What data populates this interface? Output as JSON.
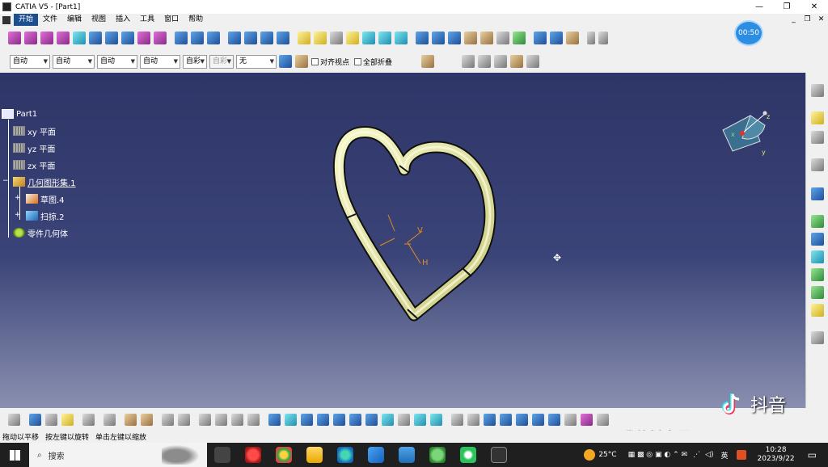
{
  "window": {
    "title": "CATIA V5 - [Part1]",
    "controls": [
      "—",
      "❐",
      "✕"
    ]
  },
  "menu": {
    "items": [
      "开始",
      "文件",
      "编辑",
      "视图",
      "插入",
      "工具",
      "窗口",
      "帮助"
    ],
    "mdi_controls": [
      "_",
      "❐",
      "✕"
    ]
  },
  "timer": {
    "label": "00:50"
  },
  "graphic_properties": {
    "combos": [
      {
        "value": "自动",
        "disabled": false
      },
      {
        "value": "自动",
        "disabled": false
      },
      {
        "value": "自动",
        "disabled": false
      },
      {
        "value": "自动",
        "disabled": false
      },
      {
        "value": "自彩",
        "disabled": false
      },
      {
        "value": "自彩",
        "disabled": true
      },
      {
        "value": "无",
        "disabled": false
      }
    ],
    "checkboxes": [
      {
        "label": "对齐视点"
      },
      {
        "label": "全部折叠"
      }
    ]
  },
  "spec_tree": {
    "root": "Part1",
    "planes": [
      "xy 平面",
      "yz 平面",
      "zx 平面"
    ],
    "geometric_set": "几何图形集.1",
    "children": [
      "草图.4",
      "扫掠.2"
    ],
    "body": "零件几何体"
  },
  "sketch_axis": {
    "v_label": "V",
    "h_label": "H"
  },
  "compass": {
    "x_label": "x",
    "y_label": "y",
    "z_label": "z"
  },
  "watermark": {
    "brand": "抖音",
    "account": "我的抖音号: 731888585"
  },
  "status": {
    "messages": [
      "拖动以平移",
      "按左键以旋转",
      "单击左键以缩放"
    ]
  },
  "taskbar": {
    "search_placeholder": "搜索",
    "weather": "25°C",
    "ime": "英",
    "time": "10:28",
    "date": "2023/9/22"
  },
  "colors": {
    "viewport_top": "#2e3567",
    "viewport_bottom": "#8a8fb0",
    "heart_tube": "#e6e7ad",
    "menu_active": "#1c4f8f",
    "timer": "#2d8de0"
  }
}
